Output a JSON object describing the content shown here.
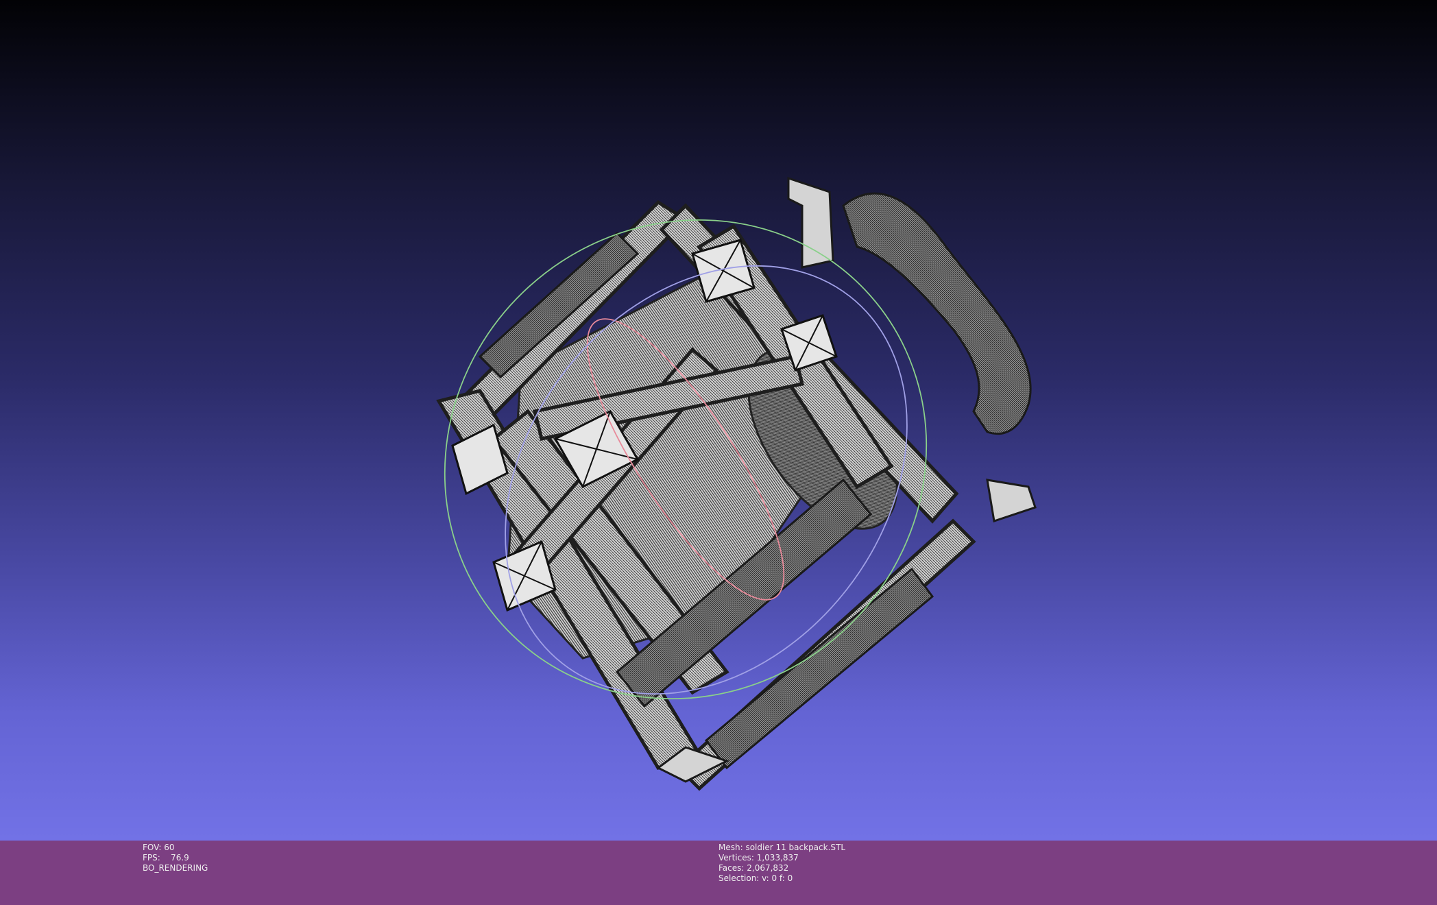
{
  "viewport": {
    "mesh_name": "soldier 11 backpack.STL"
  },
  "left_info": {
    "fov": "FOV: 60",
    "fps": "FPS:    76.9",
    "render_mode": "BO_RENDERING"
  },
  "right_info": {
    "mesh": "Mesh: soldier 11 backpack.STL",
    "vertices": "Vertices: 1,033,837",
    "faces": "Faces: 2,067,832",
    "selection": "Selection: v: 0 f: 0"
  },
  "colors": {
    "info_bar": "#7c3f82",
    "mesh_fill": "#d8d8d8",
    "mesh_wire": "#2a2a2a",
    "trackball_x": "#e88a9a",
    "trackball_y": "#8ad08a",
    "trackball_z": "#a0a0e6"
  },
  "icons": [
    "trackball-icon"
  ]
}
